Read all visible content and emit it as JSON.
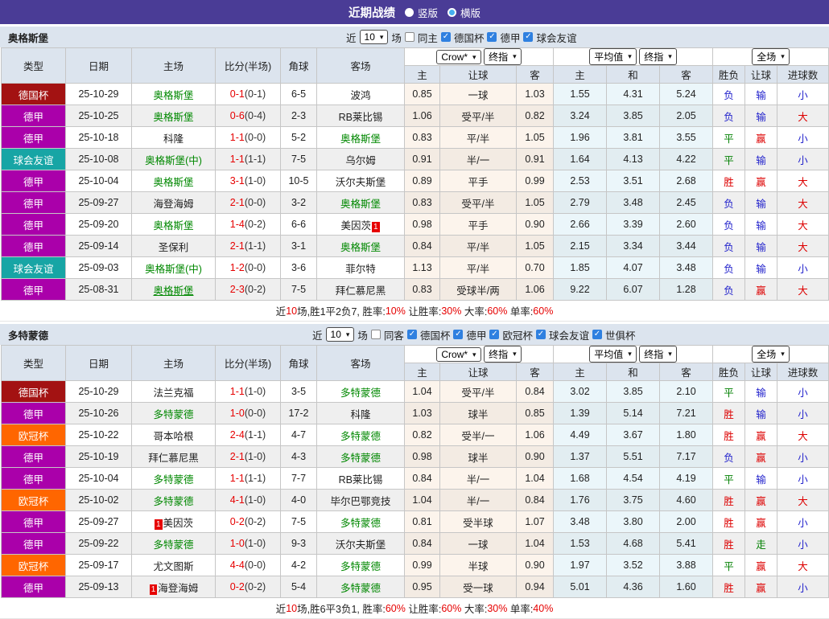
{
  "title_bar": {
    "title": "近期战绩",
    "view_options": [
      {
        "label": "竖版",
        "selected": true
      },
      {
        "label": "横版",
        "selected": false
      }
    ]
  },
  "table_header": {
    "type": "类型",
    "date": "日期",
    "home": "主场",
    "score_half": "比分(半场)",
    "corner": "角球",
    "away": "客场",
    "bookmaker_select": "Crow*",
    "final_select": "终指",
    "average_select": "平均值",
    "scope_select": "全场",
    "sub_home": "主",
    "sub_handicap": "让球",
    "sub_away": "客",
    "sub_draw": "和",
    "sub_winloss": "胜负",
    "sub_goals": "进球数"
  },
  "type_colors": {
    "德国杯": "#a31212",
    "德甲": "#aa00aa",
    "球会友谊": "#17a5a5",
    "欧冠杯": "#ff6600"
  },
  "result_colors": {
    "胜": "#dd0000",
    "平": "#008000",
    "负": "#2222cc",
    "赢": "#dd0000",
    "走": "#008000",
    "输": "#2222cc",
    "大": "#dd0000",
    "小": "#2222cc"
  },
  "sections": [
    {
      "team": "奥格斯堡",
      "filters": {
        "near": "近",
        "count": "10",
        "suffix": "场",
        "venue": {
          "label": "同主",
          "checked": false
        },
        "competitions": [
          {
            "label": "德国杯",
            "checked": true
          },
          {
            "label": "德甲",
            "checked": true
          },
          {
            "label": "球会友谊",
            "checked": true
          }
        ]
      },
      "rows": [
        {
          "type": "德国杯",
          "date": "25-10-29",
          "home": {
            "name": "奥格斯堡",
            "focus": true
          },
          "score": "0-1",
          "half": "(0-1)",
          "corners": "6-5",
          "away": {
            "name": "波鸿"
          },
          "handicap": [
            "0.85",
            "一球",
            "1.03"
          ],
          "europe": [
            "1.55",
            "4.31",
            "5.24"
          ],
          "results": [
            "负",
            "输",
            "小"
          ]
        },
        {
          "type": "德甲",
          "date": "25-10-25",
          "home": {
            "name": "奥格斯堡",
            "focus": true
          },
          "score": "0-6",
          "half": "(0-4)",
          "corners": "2-3",
          "away": {
            "name": "RB莱比锡"
          },
          "handicap": [
            "1.06",
            "受平/半",
            "0.82"
          ],
          "europe": [
            "3.24",
            "3.85",
            "2.05"
          ],
          "results": [
            "负",
            "输",
            "大"
          ]
        },
        {
          "type": "德甲",
          "date": "25-10-18",
          "home": {
            "name": "科隆"
          },
          "score": "1-1",
          "half": "(0-0)",
          "corners": "5-2",
          "away": {
            "name": "奥格斯堡",
            "focus": true
          },
          "handicap": [
            "0.83",
            "平/半",
            "1.05"
          ],
          "europe": [
            "1.96",
            "3.81",
            "3.55"
          ],
          "results": [
            "平",
            "赢",
            "小"
          ]
        },
        {
          "type": "球会友谊",
          "date": "25-10-08",
          "home": {
            "name": "奥格斯堡(中)",
            "focus": true
          },
          "score": "1-1",
          "half": "(1-1)",
          "corners": "7-5",
          "away": {
            "name": "乌尔姆"
          },
          "handicap": [
            "0.91",
            "半/一",
            "0.91"
          ],
          "europe": [
            "1.64",
            "4.13",
            "4.22"
          ],
          "results": [
            "平",
            "输",
            "小"
          ]
        },
        {
          "type": "德甲",
          "date": "25-10-04",
          "home": {
            "name": "奥格斯堡",
            "focus": true
          },
          "score": "3-1",
          "half": "(1-0)",
          "corners": "10-5",
          "away": {
            "name": "沃尔夫斯堡"
          },
          "handicap": [
            "0.89",
            "平手",
            "0.99"
          ],
          "europe": [
            "2.53",
            "3.51",
            "2.68"
          ],
          "results": [
            "胜",
            "赢",
            "大"
          ]
        },
        {
          "type": "德甲",
          "date": "25-09-27",
          "home": {
            "name": "海登海姆"
          },
          "score": "2-1",
          "half": "(0-0)",
          "corners": "3-2",
          "away": {
            "name": "奥格斯堡",
            "focus": true
          },
          "handicap": [
            "0.83",
            "受平/半",
            "1.05"
          ],
          "europe": [
            "2.79",
            "3.48",
            "2.45"
          ],
          "results": [
            "负",
            "输",
            "大"
          ]
        },
        {
          "type": "德甲",
          "date": "25-09-20",
          "home": {
            "name": "奥格斯堡",
            "focus": true
          },
          "score": "1-4",
          "half": "(0-2)",
          "corners": "6-6",
          "away": {
            "name": "美因茨",
            "badge": "1",
            "badge_pos": "after"
          },
          "handicap": [
            "0.98",
            "平手",
            "0.90"
          ],
          "europe": [
            "2.66",
            "3.39",
            "2.60"
          ],
          "results": [
            "负",
            "输",
            "大"
          ]
        },
        {
          "type": "德甲",
          "date": "25-09-14",
          "home": {
            "name": "圣保利"
          },
          "score": "2-1",
          "half": "(1-1)",
          "corners": "3-1",
          "away": {
            "name": "奥格斯堡",
            "focus": true
          },
          "handicap": [
            "0.84",
            "平/半",
            "1.05"
          ],
          "europe": [
            "2.15",
            "3.34",
            "3.44"
          ],
          "results": [
            "负",
            "输",
            "大"
          ]
        },
        {
          "type": "球会友谊",
          "date": "25-09-03",
          "home": {
            "name": "奥格斯堡(中)",
            "focus": true
          },
          "score": "1-2",
          "half": "(0-0)",
          "corners": "3-6",
          "away": {
            "name": "菲尔特"
          },
          "handicap": [
            "1.13",
            "平/半",
            "0.70"
          ],
          "europe": [
            "1.85",
            "4.07",
            "3.48"
          ],
          "results": [
            "负",
            "输",
            "小"
          ]
        },
        {
          "type": "德甲",
          "date": "25-08-31",
          "home": {
            "name": "奥格斯堡",
            "focus": true,
            "underline": true
          },
          "score": "2-3",
          "half": "(0-2)",
          "corners": "7-5",
          "away": {
            "name": "拜仁慕尼黑"
          },
          "handicap": [
            "0.83",
            "受球半/两",
            "1.06"
          ],
          "europe": [
            "9.22",
            "6.07",
            "1.28"
          ],
          "results": [
            "负",
            "赢",
            "大"
          ]
        }
      ],
      "summary": [
        {
          "text": "近",
          "red": false
        },
        {
          "text": "10",
          "red": true
        },
        {
          "text": "场,胜1平2负7, 胜率:",
          "red": false
        },
        {
          "text": "10%",
          "red": true
        },
        {
          "text": " 让胜率:",
          "red": false
        },
        {
          "text": "30%",
          "red": true
        },
        {
          "text": " 大率:",
          "red": false
        },
        {
          "text": "60%",
          "red": true
        },
        {
          "text": " 单率:",
          "red": false
        },
        {
          "text": "60%",
          "red": true
        }
      ]
    },
    {
      "team": "多特蒙德",
      "filters": {
        "near": "近",
        "count": "10",
        "suffix": "场",
        "venue": {
          "label": "同客",
          "checked": false
        },
        "competitions": [
          {
            "label": "德国杯",
            "checked": true
          },
          {
            "label": "德甲",
            "checked": true
          },
          {
            "label": "欧冠杯",
            "checked": true
          },
          {
            "label": "球会友谊",
            "checked": true
          },
          {
            "label": "世俱杯",
            "checked": true
          }
        ]
      },
      "rows": [
        {
          "type": "德国杯",
          "date": "25-10-29",
          "home": {
            "name": "法兰克福"
          },
          "score": "1-1",
          "half": "(1-0)",
          "corners": "3-5",
          "away": {
            "name": "多特蒙德",
            "focus": true
          },
          "handicap": [
            "1.04",
            "受平/半",
            "0.84"
          ],
          "europe": [
            "3.02",
            "3.85",
            "2.10"
          ],
          "results": [
            "平",
            "输",
            "小"
          ]
        },
        {
          "type": "德甲",
          "date": "25-10-26",
          "home": {
            "name": "多特蒙德",
            "focus": true
          },
          "score": "1-0",
          "half": "(0-0)",
          "corners": "17-2",
          "away": {
            "name": "科隆"
          },
          "handicap": [
            "1.03",
            "球半",
            "0.85"
          ],
          "europe": [
            "1.39",
            "5.14",
            "7.21"
          ],
          "results": [
            "胜",
            "输",
            "小"
          ]
        },
        {
          "type": "欧冠杯",
          "date": "25-10-22",
          "home": {
            "name": "哥本哈根"
          },
          "score": "2-4",
          "half": "(1-1)",
          "corners": "4-7",
          "away": {
            "name": "多特蒙德",
            "focus": true
          },
          "handicap": [
            "0.82",
            "受半/一",
            "1.06"
          ],
          "europe": [
            "4.49",
            "3.67",
            "1.80"
          ],
          "results": [
            "胜",
            "赢",
            "大"
          ]
        },
        {
          "type": "德甲",
          "date": "25-10-19",
          "home": {
            "name": "拜仁慕尼黑"
          },
          "score": "2-1",
          "half": "(1-0)",
          "corners": "4-3",
          "away": {
            "name": "多特蒙德",
            "focus": true
          },
          "handicap": [
            "0.98",
            "球半",
            "0.90"
          ],
          "europe": [
            "1.37",
            "5.51",
            "7.17"
          ],
          "results": [
            "负",
            "赢",
            "小"
          ]
        },
        {
          "type": "德甲",
          "date": "25-10-04",
          "home": {
            "name": "多特蒙德",
            "focus": true
          },
          "score": "1-1",
          "half": "(1-1)",
          "corners": "7-7",
          "away": {
            "name": "RB莱比锡"
          },
          "handicap": [
            "0.84",
            "半/一",
            "1.04"
          ],
          "europe": [
            "1.68",
            "4.54",
            "4.19"
          ],
          "results": [
            "平",
            "输",
            "小"
          ]
        },
        {
          "type": "欧冠杯",
          "date": "25-10-02",
          "home": {
            "name": "多特蒙德",
            "focus": true
          },
          "score": "4-1",
          "half": "(1-0)",
          "corners": "4-0",
          "away": {
            "name": "毕尔巴鄂竞技"
          },
          "handicap": [
            "1.04",
            "半/一",
            "0.84"
          ],
          "europe": [
            "1.76",
            "3.75",
            "4.60"
          ],
          "results": [
            "胜",
            "赢",
            "大"
          ]
        },
        {
          "type": "德甲",
          "date": "25-09-27",
          "home": {
            "name": "美因茨",
            "badge": "1",
            "badge_pos": "before"
          },
          "score": "0-2",
          "half": "(0-2)",
          "corners": "7-5",
          "away": {
            "name": "多特蒙德",
            "focus": true
          },
          "handicap": [
            "0.81",
            "受半球",
            "1.07"
          ],
          "europe": [
            "3.48",
            "3.80",
            "2.00"
          ],
          "results": [
            "胜",
            "赢",
            "小"
          ]
        },
        {
          "type": "德甲",
          "date": "25-09-22",
          "home": {
            "name": "多特蒙德",
            "focus": true
          },
          "score": "1-0",
          "half": "(1-0)",
          "corners": "9-3",
          "away": {
            "name": "沃尔夫斯堡"
          },
          "handicap": [
            "0.84",
            "一球",
            "1.04"
          ],
          "europe": [
            "1.53",
            "4.68",
            "5.41"
          ],
          "results": [
            "胜",
            "走",
            "小"
          ]
        },
        {
          "type": "欧冠杯",
          "date": "25-09-17",
          "home": {
            "name": "尤文图斯"
          },
          "score": "4-4",
          "half": "(0-0)",
          "corners": "4-2",
          "away": {
            "name": "多特蒙德",
            "focus": true
          },
          "handicap": [
            "0.99",
            "半球",
            "0.90"
          ],
          "europe": [
            "1.97",
            "3.52",
            "3.88"
          ],
          "results": [
            "平",
            "赢",
            "大"
          ]
        },
        {
          "type": "德甲",
          "date": "25-09-13",
          "home": {
            "name": "海登海姆",
            "badge": "1",
            "badge_pos": "before"
          },
          "score": "0-2",
          "half": "(0-2)",
          "corners": "5-4",
          "away": {
            "name": "多特蒙德",
            "focus": true
          },
          "handicap": [
            "0.95",
            "受一球",
            "0.94"
          ],
          "europe": [
            "5.01",
            "4.36",
            "1.60"
          ],
          "results": [
            "胜",
            "赢",
            "小"
          ]
        }
      ],
      "summary": [
        {
          "text": "近",
          "red": false
        },
        {
          "text": "10",
          "red": true
        },
        {
          "text": "场,胜6平3负1, 胜率:",
          "red": false
        },
        {
          "text": "60%",
          "red": true
        },
        {
          "text": " 让胜率:",
          "red": false
        },
        {
          "text": "60%",
          "red": true
        },
        {
          "text": " 大率:",
          "red": false
        },
        {
          "text": "30%",
          "red": true
        },
        {
          "text": " 单率:",
          "red": false
        },
        {
          "text": "40%",
          "red": true
        }
      ]
    }
  ]
}
